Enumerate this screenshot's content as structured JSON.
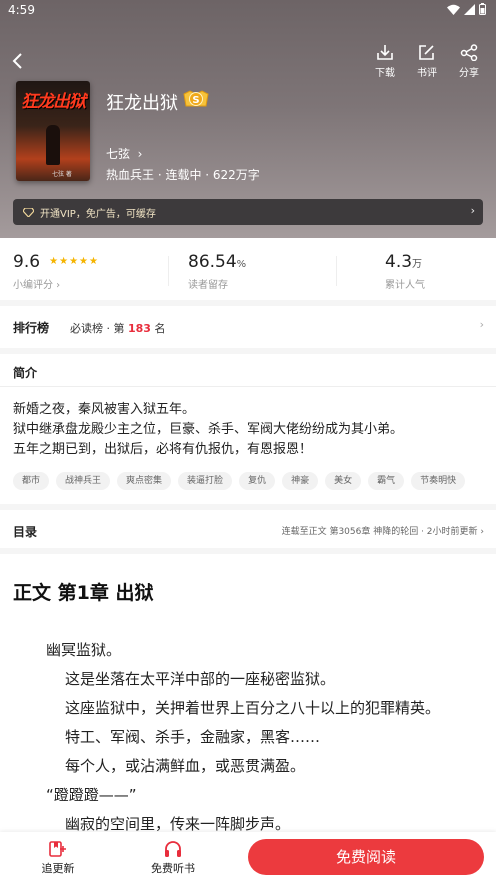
{
  "status_bar": {
    "time": "4:59"
  },
  "header": {
    "actions": [
      {
        "label": "下载",
        "icon": "download-icon"
      },
      {
        "label": "书评",
        "icon": "edit-icon"
      },
      {
        "label": "分享",
        "icon": "share-icon"
      }
    ]
  },
  "book": {
    "cover_title": "狂龙出狱",
    "cover_author": "七弦 著",
    "title": "狂龙出狱",
    "badge": "S",
    "author": "七弦",
    "meta": "热血兵王 · 连载中 · 622万字"
  },
  "vip_banner": {
    "text": "开通VIP，免广告，可缓存"
  },
  "stats": {
    "rating": {
      "value": "9.6",
      "stars": 5,
      "label": "小编评分"
    },
    "retention": {
      "value": "86.54",
      "unit": "%",
      "label": "读者留存"
    },
    "readers": {
      "value": "4.3",
      "unit": "万",
      "label": "累计人气"
    }
  },
  "ranking": {
    "heading": "排行榜",
    "board": "必读榜",
    "prefix": "· 第",
    "rank": "183",
    "suffix": "名"
  },
  "intro": {
    "heading": "简介",
    "lines": [
      "新婚之夜，秦风被害入狱五年。",
      "狱中继承盘龙殿少主之位，巨豪、杀手、军阀大佬纷纷成为其小弟。",
      "五年之期已到，出狱后，必将有仇报仇，有恩报恩！"
    ],
    "tags": [
      "都市",
      "战神兵王",
      "爽点密集",
      "装逼打脸",
      "复仇",
      "神豪",
      "美女",
      "霸气",
      "节奏明快"
    ]
  },
  "toc": {
    "heading": "目录",
    "latest": "连载至正文 第3056章 神降的轮回 · 2小时前更新"
  },
  "chapter": {
    "title": "正文 第1章 出狱",
    "paragraphs": [
      "幽冥监狱。",
      "这是坐落在太平洋中部的一座秘密监狱。",
      "这座监狱中，关押着世界上百分之八十以上的犯罪精英。",
      "特工、军阀、杀手，金融家，黑客……",
      "每个人，或沾满鲜血，或恶贯满盈。",
      "“蹬蹬蹬——”",
      "幽寂的空间里，传来一阵脚步声。"
    ]
  },
  "bottom_bar": {
    "follow_label": "追更新",
    "listen_label": "免费听书",
    "read_label": "免费阅读"
  },
  "colors": {
    "accent": "#ec3a3e",
    "rank_red": "#e82d3c",
    "star": "#f5b400",
    "vip_text": "#f1e4c4"
  }
}
